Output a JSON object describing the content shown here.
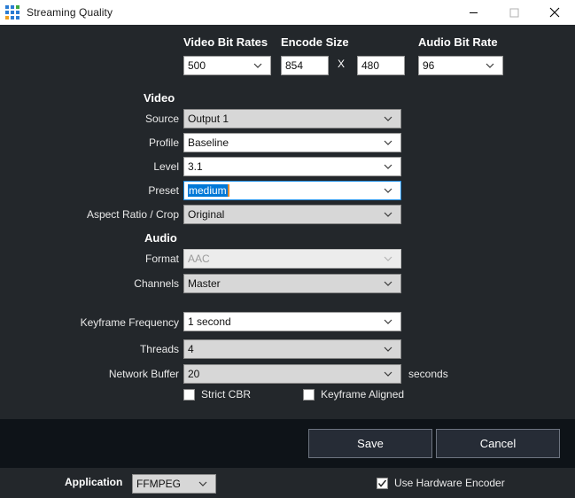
{
  "window": {
    "title": "Streaming Quality",
    "icon": "app-grid-icon",
    "icon_colors": [
      "#2b7cd3",
      "#2b7cd3",
      "#3faa3f",
      "#2b7cd3",
      "#2b7cd3",
      "#2b7cd3",
      "#f0a020",
      "#2b7cd3",
      "#2b7cd3"
    ],
    "controls": {
      "minimize": "minimize-icon",
      "maximize": "maximize-icon",
      "close": "close-icon"
    }
  },
  "top_row": {
    "headers": {
      "video_bit_rates": "Video Bit Rates",
      "encode_size": "Encode Size",
      "audio_bit_rate": "Audio Bit Rate"
    },
    "video_bit_rate": {
      "value": "500",
      "type": "combobox"
    },
    "encode_width": {
      "value": "854",
      "type": "text"
    },
    "encode_separator": "X",
    "encode_height": {
      "value": "480",
      "type": "text"
    },
    "audio_bit_rate": {
      "value": "96",
      "type": "combobox"
    }
  },
  "video_section": {
    "title": "Video",
    "rows": [
      {
        "label": "Source",
        "value": "Output 1",
        "state": "grey"
      },
      {
        "label": "Profile",
        "value": "Baseline",
        "state": "white"
      },
      {
        "label": "Level",
        "value": "3.1",
        "state": "white"
      },
      {
        "label": "Preset",
        "value": "medium",
        "state": "focused-selected"
      },
      {
        "label": "Aspect Ratio / Crop",
        "value": "Original",
        "state": "grey"
      }
    ]
  },
  "audio_section": {
    "title": "Audio",
    "rows": [
      {
        "label": "Format",
        "value": "AAC",
        "state": "disabled"
      },
      {
        "label": "Channels",
        "value": "Master",
        "state": "grey"
      }
    ]
  },
  "encoder_section": {
    "rows": [
      {
        "label": "Keyframe Frequency",
        "value": "1 second",
        "state": "white"
      },
      {
        "label": "Threads",
        "value": "4",
        "state": "grey"
      },
      {
        "label": "Network Buffer",
        "value": "20",
        "state": "grey",
        "suffix": "seconds"
      }
    ]
  },
  "checkboxes": {
    "strict_cbr": {
      "label": "Strict CBR",
      "checked": false
    },
    "keyframe_aligned": {
      "label": "Keyframe Aligned",
      "checked": false
    }
  },
  "buttons": {
    "save": "Save",
    "cancel": "Cancel"
  },
  "bottom_bar": {
    "application_label": "Application",
    "application_value": "FFMPEG",
    "hardware_encoder": {
      "label": "Use Hardware Encoder",
      "checked": true
    }
  },
  "colors": {
    "background": "#23272b",
    "button_strip": "#0e1318",
    "titlebar": "#ffffff",
    "selection": "#0078d7",
    "focus_border": "#1b8ce3",
    "caret": "#e08a30"
  }
}
